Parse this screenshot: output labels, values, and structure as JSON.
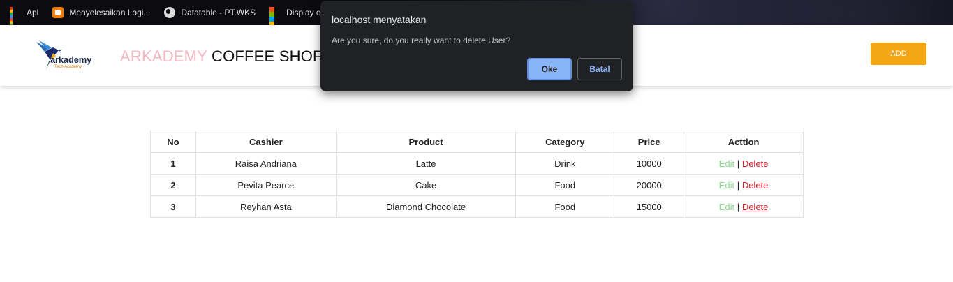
{
  "bookmarks": [
    {
      "label": "Apl",
      "icon": "apps-grid-icon"
    },
    {
      "label": "Menyelesaikan Logi...",
      "icon": "blogger-icon"
    },
    {
      "label": "Datatable - PT.WKS",
      "icon": "globe-icon"
    },
    {
      "label": "Display or hi",
      "icon": "microsoft-icon"
    }
  ],
  "header": {
    "logo_text": "arkademy",
    "logo_sub": "Tech Academy",
    "brand_accent": "ARKADEMY",
    "brand_rest": "COFFEE SHOP",
    "add_label": "ADD"
  },
  "table": {
    "headers": [
      "No",
      "Cashier",
      "Product",
      "Category",
      "Price",
      "Acttion"
    ],
    "rows": [
      {
        "no": "1",
        "cashier": "Raisa Andriana",
        "product": "Latte",
        "category": "Drink",
        "price": "10000",
        "edit": "Edit",
        "sep": "|",
        "delete": "Delete"
      },
      {
        "no": "2",
        "cashier": "Pevita Pearce",
        "product": "Cake",
        "category": "Food",
        "price": "20000",
        "edit": "Edit",
        "sep": "|",
        "delete": "Delete"
      },
      {
        "no": "3",
        "cashier": "Reyhan Asta",
        "product": "Diamond Chocolate",
        "category": "Food",
        "price": "15000",
        "edit": "Edit",
        "sep": "|",
        "delete": "Delete"
      }
    ]
  },
  "dialog": {
    "title": "localhost menyatakan",
    "message": "Are you sure, do you really want to delete User?",
    "ok_label": "Oke",
    "cancel_label": "Batal"
  },
  "colors": {
    "brand_accent": "#f6b7c3",
    "add_button": "#f4a614",
    "edit_link": "#8cd98c",
    "delete_link": "#dc1e2d",
    "dialog_bg": "#202124",
    "ok_button": "#8ab4f8"
  }
}
